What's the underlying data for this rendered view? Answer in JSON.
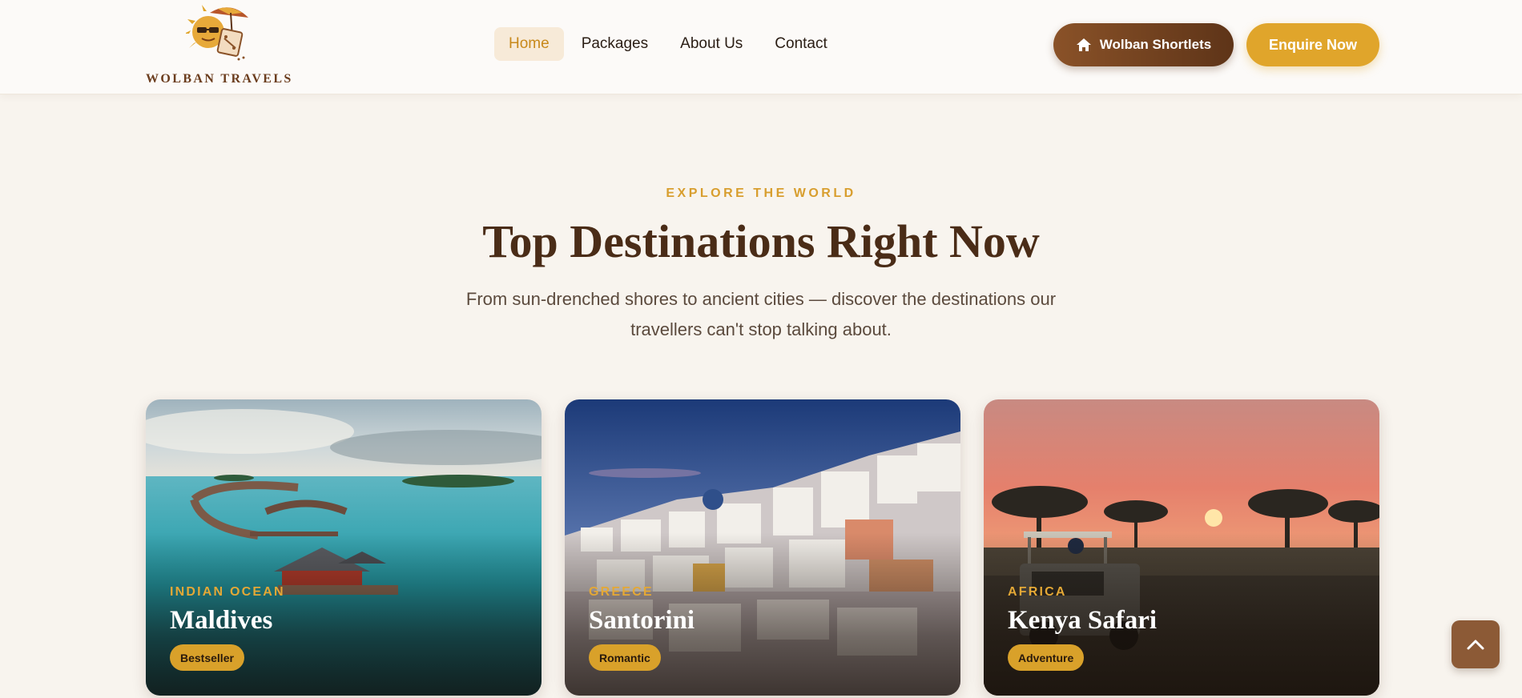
{
  "brand": {
    "name": "WOLBAN TRAVELS",
    "logo_icon": "sun-umbrella-suitcase-logo",
    "colors": {
      "gold": "#e0a52b",
      "brown": "#6b3d1e",
      "dark_brown": "#4a2c17"
    }
  },
  "nav": {
    "items": [
      {
        "label": "Home",
        "active": true
      },
      {
        "label": "Packages",
        "active": false
      },
      {
        "label": "About Us",
        "active": false
      },
      {
        "label": "Contact",
        "active": false
      }
    ]
  },
  "header_actions": {
    "shortlets_label": "Wolban Shortlets",
    "shortlets_icon": "home-icon",
    "enquire_label": "Enquire Now"
  },
  "section": {
    "eyebrow": "EXPLORE THE WORLD",
    "title": "Top Destinations Right Now",
    "subtitle": "From sun-drenched shores to ancient cities — discover the destinations our travellers can't stop talking about."
  },
  "destinations": [
    {
      "region": "INDIAN OCEAN",
      "name": "Maldives",
      "badge": "Bestseller"
    },
    {
      "region": "GREECE",
      "name": "Santorini",
      "badge": "Romantic"
    },
    {
      "region": "AFRICA",
      "name": "Kenya Safari",
      "badge": "Adventure"
    }
  ],
  "back_to_top_icon": "chevron-up-icon"
}
